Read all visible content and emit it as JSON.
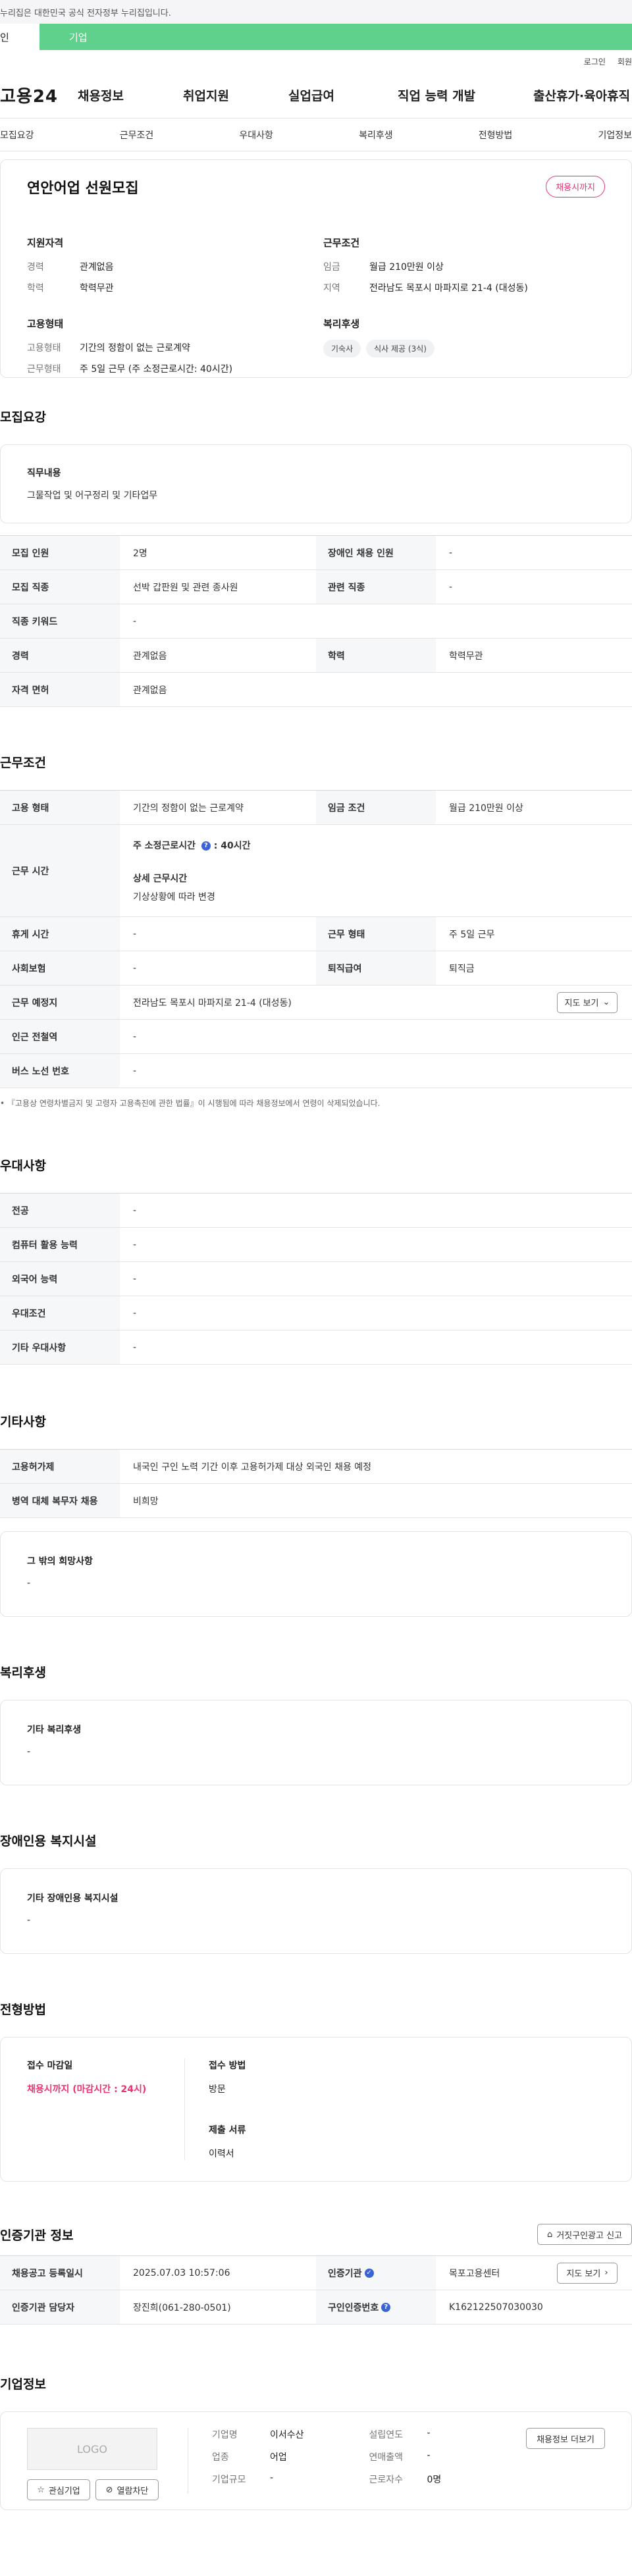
{
  "top_notice": "누리집은 대한민국 공식 전자정부 누리집입니다.",
  "user_tabs": {
    "personal": "인",
    "corporate": "기업"
  },
  "utility": {
    "login": "로그인",
    "signup": "회원"
  },
  "logo": "고용24",
  "gnb": [
    "채용정보",
    "취업지원",
    "실업급여",
    "직업 능력 개발",
    "출산휴가·육아휴직"
  ],
  "subnav": [
    "모집요강",
    "근무조건",
    "우대사항",
    "복리후생",
    "전형방법",
    "기업정보"
  ],
  "job": {
    "title": "연안어업 선원모집",
    "status_badge": "채용시까지",
    "qual_title": "지원자격",
    "career_label": "경력",
    "career_value": "관계없음",
    "edu_label": "학력",
    "edu_value": "학력무관",
    "cond_title": "근무조건",
    "wage_label": "임금",
    "wage_value": "월급 210만원 이상",
    "region_label": "지역",
    "region_value": "전라남도 목포시 마파지로 21-4 (대성동)",
    "emp_title": "고용형태",
    "emp_type_label": "고용형태",
    "emp_type_value": "기간의 정함이 없는 근로계약",
    "work_form_label": "근무형태",
    "work_form_value": "주 5일 근무 (주 소정근로시간: 40시간)",
    "welfare_title": "복리후생",
    "welfare_chips": [
      "기숙사",
      "식사 제공 (3식)"
    ]
  },
  "recruit": {
    "section_title": "모집요강",
    "duty_title": "직무내용",
    "duty_value": "그물작업 및 어구정리 및 기타업무",
    "rows": [
      [
        {
          "th": "모집 인원",
          "td": "2명"
        },
        {
          "th": "장애인 채용 인원",
          "td": "-"
        }
      ],
      [
        {
          "th": "모집 직종",
          "td": "선박 갑판원 및 관련 종사원"
        },
        {
          "th": "관련 직종",
          "td": "-"
        }
      ],
      [
        {
          "th": "직종 키워드",
          "td": "-"
        }
      ],
      [
        {
          "th": "경력",
          "td": "관계없음"
        },
        {
          "th": "학력",
          "td": "학력무관"
        }
      ],
      [
        {
          "th": "자격 면허",
          "td": "관계없음"
        }
      ]
    ]
  },
  "conditions": {
    "section_title": "근무조건",
    "emp_th": "고용 형태",
    "emp_td": "기간의 정함이 없는 근로계약",
    "wage_th": "임금 조건",
    "wage_td": "월급 210만원 이상",
    "hours_th": "근무 시간",
    "hours_label": "주 소정근로시간",
    "hours_value": "40시간",
    "hours_detail_title": "상세 근무시간",
    "hours_detail_value": "기상상황에 따라 변경",
    "rest_th": "휴게 시간",
    "rest_td": "-",
    "form_th": "근무 형태",
    "form_td": "주 5일 근무",
    "insurance_th": "사회보험",
    "insurance_td": "-",
    "severance_th": "퇴직급여",
    "severance_td": "퇴직금",
    "place_th": "근무 예정지",
    "place_td": "전라남도 목포시 마파지로 21-4 (대성동)",
    "map_button": "지도 보기",
    "station_th": "인근 전철역",
    "station_td": "-",
    "bus_th": "버스 노선 번호",
    "bus_td": "-",
    "footnote": "『고용상 연령차별금지 및 고령자 고용촉진에 관한 법률』이 시행됨에 따라 채용정보에서 연령이 삭제되었습니다."
  },
  "preference": {
    "section_title": "우대사항",
    "rows": [
      {
        "th": "전공",
        "td": "-"
      },
      {
        "th": "컴퓨터 활용 능력",
        "td": "-"
      },
      {
        "th": "외국어 능력",
        "td": "-"
      },
      {
        "th": "우대조건",
        "td": "-"
      },
      {
        "th": "기타 우대사항",
        "td": "-"
      }
    ]
  },
  "etc": {
    "section_title": "기타사항",
    "rows": [
      {
        "th": "고용허가제",
        "td": "내국인 구인 노력 기간 이후 고용허가제 대상 외국인 채용 예정"
      },
      {
        "th": "병역 대체 복무자 채용",
        "td": "비희망"
      }
    ],
    "wish_title": "그 밖의 희망사항",
    "wish_value": "-"
  },
  "welfare": {
    "section_title": "복리후생",
    "box_title": "기타 복리후생",
    "box_value": "-"
  },
  "disability": {
    "section_title": "장애인용 복지시설",
    "box_title": "기타 장애인용 복지시설",
    "box_value": "-"
  },
  "selection": {
    "section_title": "전형방법",
    "deadline_title": "접수 마감일",
    "deadline_value": "채용시까지 (마감시간 : 24시)",
    "method_title": "접수 방법",
    "method_value": "방문",
    "docs_title": "제출 서류",
    "docs_value": "이력서"
  },
  "cert": {
    "section_title": "인증기관 정보",
    "report_button": "거짓구인광고 신고",
    "reg_date_th": "채용공고 등록일시",
    "reg_date_td": "2025.07.03 10:57:06",
    "agency_th": "인증기관",
    "agency_td": "목포고용센터",
    "map_button": "지도 보기",
    "manager_th": "인증기관 담당자",
    "manager_td": "장진희(061-280-0501)",
    "cert_no_th": "구인인증번호",
    "cert_no_td": "K162122507030030"
  },
  "company": {
    "section_title": "기업정보",
    "logo_text": "LOGO",
    "fav_button": "관심기업",
    "block_button": "열람차단",
    "name_label": "기업명",
    "name_value": "이서수산",
    "industry_label": "업종",
    "industry_value": "어업",
    "size_label": "기업규모",
    "size_value": "-",
    "founded_label": "설립연도",
    "founded_value": "-",
    "revenue_label": "연매출액",
    "revenue_value": "-",
    "employees_label": "근로자수",
    "employees_value": "0명",
    "jobs_button": "채용정보 더보기"
  },
  "colors": {
    "green": "#5fd18c",
    "pink": "#e8336e",
    "blue": "#3a63d8"
  }
}
